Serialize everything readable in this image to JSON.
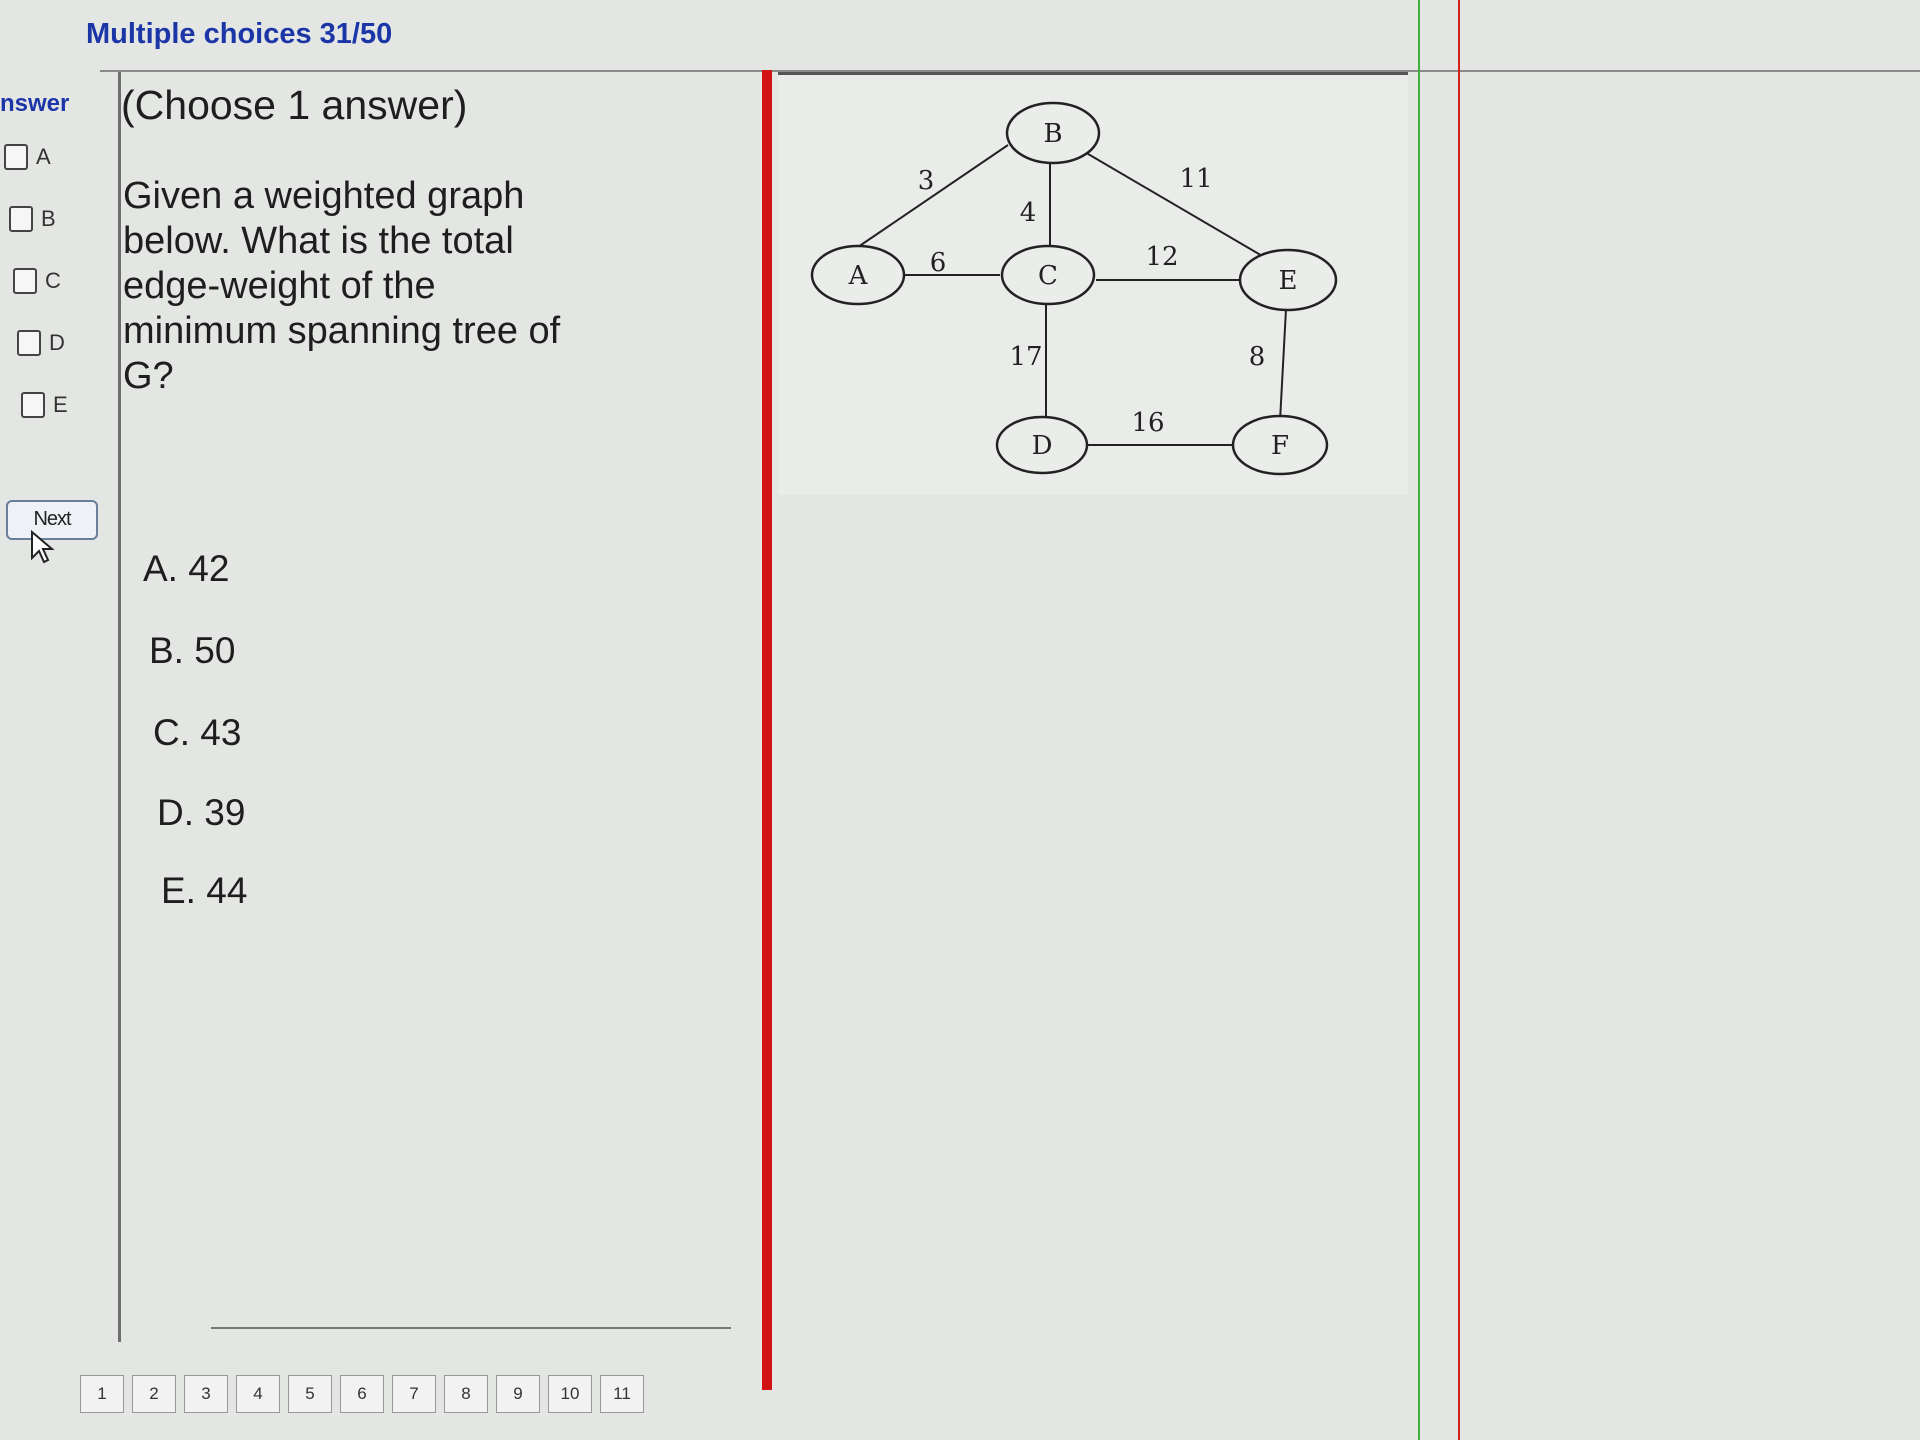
{
  "header": {
    "title": "Multiple choices 31/50"
  },
  "answer_column": {
    "header": "nswer",
    "options": [
      "A",
      "B",
      "C",
      "D",
      "E"
    ],
    "next_label": "Next"
  },
  "question": {
    "instruction": "(Choose 1 answer)",
    "text": "Given a weighted graph below. What is the total edge-weight of the minimum spanning tree of G?",
    "choices": [
      "A. 42",
      "B. 50",
      "C. 43",
      "D. 39",
      "E. 44"
    ]
  },
  "graph": {
    "nodes": [
      "A",
      "B",
      "C",
      "D",
      "E",
      "F"
    ],
    "edges": [
      {
        "from": "A",
        "to": "B",
        "weight": "3"
      },
      {
        "from": "A",
        "to": "C",
        "weight": "6"
      },
      {
        "from": "B",
        "to": "C",
        "weight": "4"
      },
      {
        "from": "B",
        "to": "E",
        "weight": "11"
      },
      {
        "from": "C",
        "to": "E",
        "weight": "12"
      },
      {
        "from": "C",
        "to": "D",
        "weight": "17"
      },
      {
        "from": "E",
        "to": "F",
        "weight": "8"
      },
      {
        "from": "D",
        "to": "F",
        "weight": "16"
      }
    ]
  },
  "pagination": [
    "1",
    "2",
    "3",
    "4",
    "5",
    "6",
    "7",
    "8",
    "9",
    "10",
    "11"
  ],
  "colors": {
    "header_text": "#1c36a8",
    "divider_red": "#d11313",
    "divider_green": "#3fae3f"
  }
}
